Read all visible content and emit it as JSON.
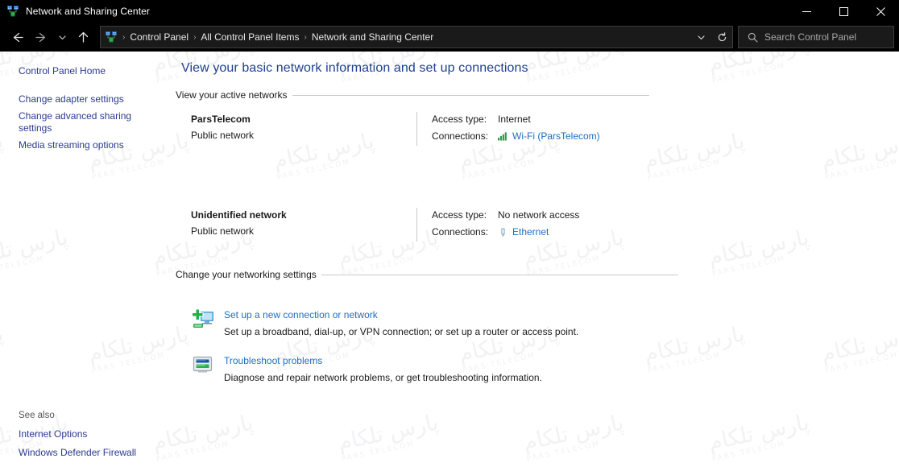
{
  "window": {
    "title": "Network and Sharing Center",
    "icon": "network-sharing-center-icon",
    "controls": {
      "minimize": "–",
      "maximize": "□",
      "close": "✕"
    }
  },
  "navbar": {
    "back_icon": "back-arrow-icon",
    "forward_icon": "forward-arrow-icon",
    "recent_icon": "chevron-down-icon",
    "up_icon": "up-arrow-icon",
    "address_icon": "network-sharing-center-icon",
    "breadcrumbs": [
      "Control Panel",
      "All Control Panel Items",
      "Network and Sharing Center"
    ],
    "separator": "›",
    "dropdown_icon": "chevron-down-icon",
    "refresh_icon": "refresh-icon"
  },
  "search": {
    "placeholder": "Search Control Panel",
    "value": "",
    "icon": "search-icon"
  },
  "sidebar": {
    "home_label": "Control Panel Home",
    "items": [
      {
        "label": "Change adapter settings"
      },
      {
        "label": "Change advanced sharing settings"
      },
      {
        "label": "Media streaming options"
      }
    ],
    "see_also": {
      "label": "See also",
      "items": [
        {
          "label": "Internet Options"
        },
        {
          "label": "Windows Defender Firewall"
        }
      ]
    }
  },
  "main": {
    "heading": "View your basic network information and set up connections",
    "active_networks": {
      "title": "View your active networks",
      "field_labels": {
        "access_type": "Access type:",
        "connections": "Connections:"
      },
      "rows": [
        {
          "name": "ParsTelecom",
          "type": "Public network",
          "access_type": "Internet",
          "connection_label": "Wi-Fi (ParsTelecom)",
          "connection_icon": "wifi-signal-icon"
        },
        {
          "name": "Unidentified network",
          "type": "Public network",
          "access_type": "No network access",
          "connection_label": "Ethernet",
          "connection_icon": "ethernet-port-icon"
        }
      ]
    },
    "settings": {
      "title": "Change your networking settings",
      "tasks": [
        {
          "title": "Set up a new connection or network",
          "description": "Set up a broadband, dial-up, or VPN connection; or set up a router or access point.",
          "icon": "new-connection-icon"
        },
        {
          "title": "Troubleshoot problems",
          "description": "Diagnose and repair network problems, or get troubleshooting information.",
          "icon": "troubleshoot-icon"
        }
      ]
    }
  },
  "watermark": {
    "text_fa": "پارس تلکام",
    "text_en": "PARS TELECOM",
    "color": "#f1f2f4"
  },
  "theme": {
    "titlebar_bg": "#000000",
    "content_bg": "#ffffff",
    "heading_color": "#1f3f8f",
    "link_color": "#1d6fc4",
    "sidebar_link_color": "#2b3a8f",
    "rule_color": "#c9c9c9"
  }
}
